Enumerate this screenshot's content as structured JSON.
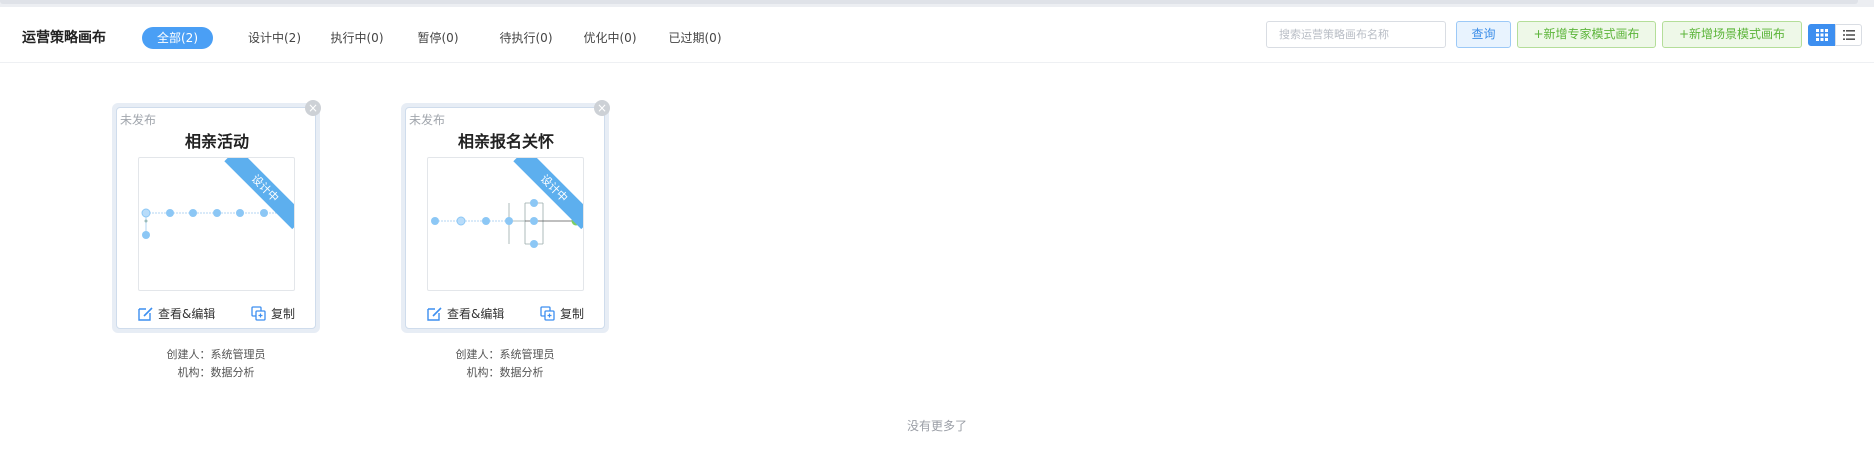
{
  "header": {
    "title": "运营策略画布",
    "tabs": [
      {
        "label": "全部(2)",
        "active": true
      },
      {
        "label": "设计中(2)",
        "active": false
      },
      {
        "label": "执行中(0)",
        "active": false
      },
      {
        "label": "暂停(0)",
        "active": false
      },
      {
        "label": "待执行(0)",
        "active": false
      },
      {
        "label": "优化中(0)",
        "active": false
      },
      {
        "label": "已过期(0)",
        "active": false
      }
    ],
    "search": {
      "placeholder": "搜索运营策略画布名称",
      "value": ""
    },
    "query_label": "查询",
    "add_expert_label": "+新增专家模式画布",
    "add_scene_label": "+新增场景模式画布",
    "view_mode": "grid"
  },
  "cards": [
    {
      "status": "未发布",
      "name": "相亲活动",
      "ribbon": "设计中",
      "edit_label": "查看&编辑",
      "copy_label": "复制",
      "creator": "创建人：系统管理员",
      "org": "机构：数据分析"
    },
    {
      "status": "未发布",
      "name": "相亲报名关怀",
      "ribbon": "设计中",
      "edit_label": "查看&编辑",
      "copy_label": "复制",
      "creator": "创建人：系统管理员",
      "org": "机构：数据分析"
    }
  ],
  "footer": {
    "no_more": "没有更多了"
  },
  "colors": {
    "accent": "#4a9ff5",
    "green": "#5cb53a",
    "ribbon": "#5dafee",
    "node": "#8cc7f5",
    "end_node": "#7ccd62"
  },
  "icons": [
    "close-icon",
    "edit-icon",
    "copy-icon",
    "grid-view-icon",
    "list-view-icon"
  ]
}
